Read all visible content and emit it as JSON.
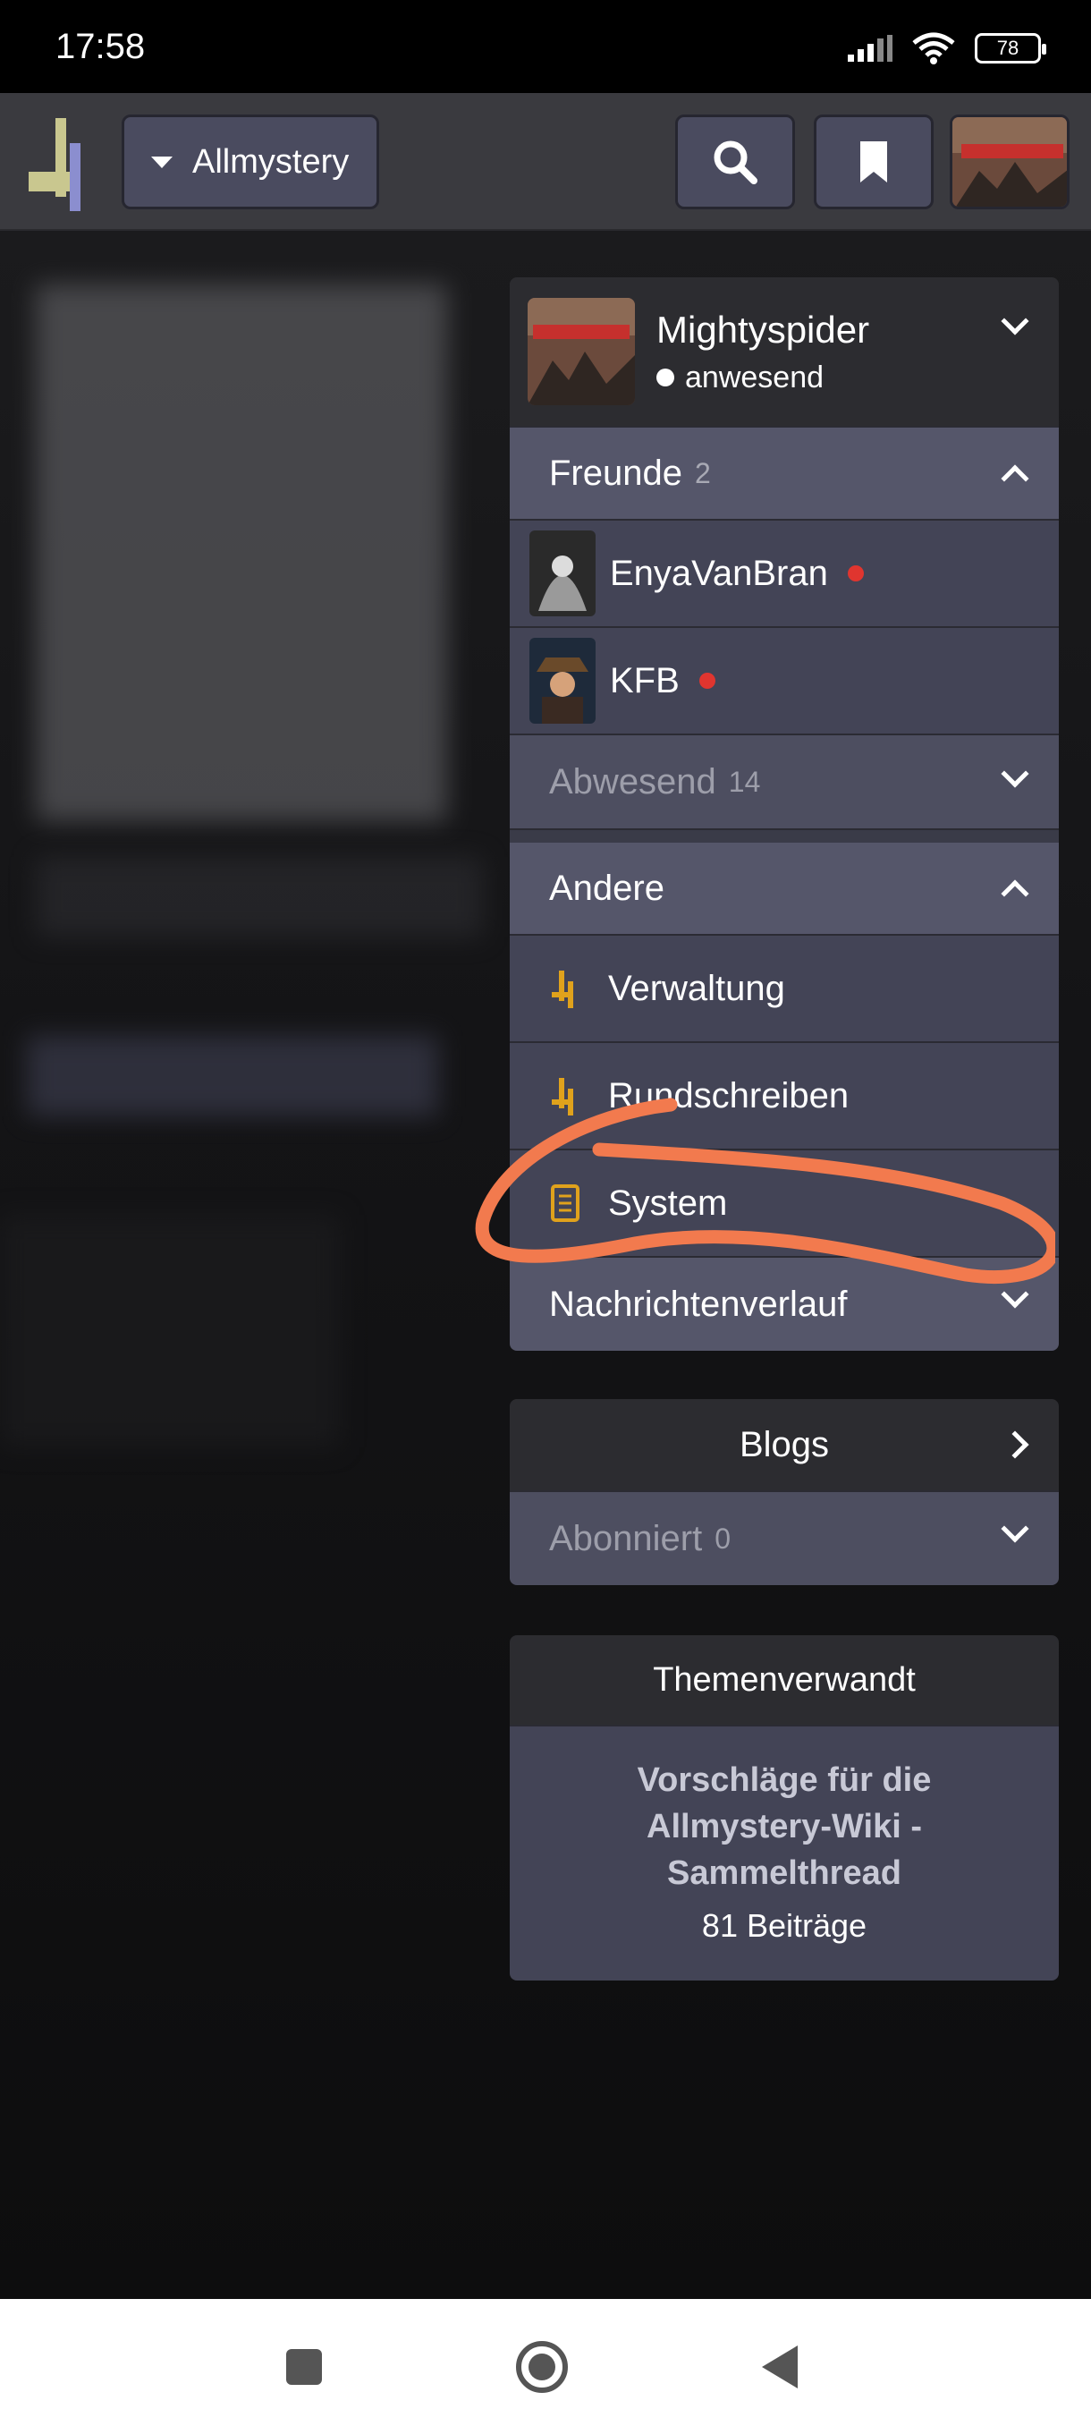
{
  "status_bar": {
    "time": "17:58",
    "battery": "78"
  },
  "header": {
    "forum_selector": "Allmystery"
  },
  "user_card": {
    "username": "Mightyspider",
    "status": "anwesend"
  },
  "friends": {
    "label": "Freunde",
    "count": "2",
    "online": [
      {
        "name": "EnyaVanBran"
      },
      {
        "name": "KFB"
      }
    ],
    "away_label": "Abwesend",
    "away_count": "14"
  },
  "other": {
    "label": "Andere",
    "items": [
      {
        "label": "Verwaltung"
      },
      {
        "label": "Rundschreiben"
      },
      {
        "label": "System"
      }
    ],
    "history_label": "Nachrichtenverlauf"
  },
  "blogs": {
    "label": "Blogs",
    "subscribed_label": "Abonniert",
    "subscribed_count": "0"
  },
  "related": {
    "heading": "Themenverwandt",
    "thread_title": "Vorschläge für die Allmystery-Wiki - Sammelthread",
    "posts": "81 Beiträge"
  },
  "colors": {
    "annotation": "#f27a4e",
    "accent_icon": "#e0a21c",
    "online_dot": "#e0352f"
  }
}
